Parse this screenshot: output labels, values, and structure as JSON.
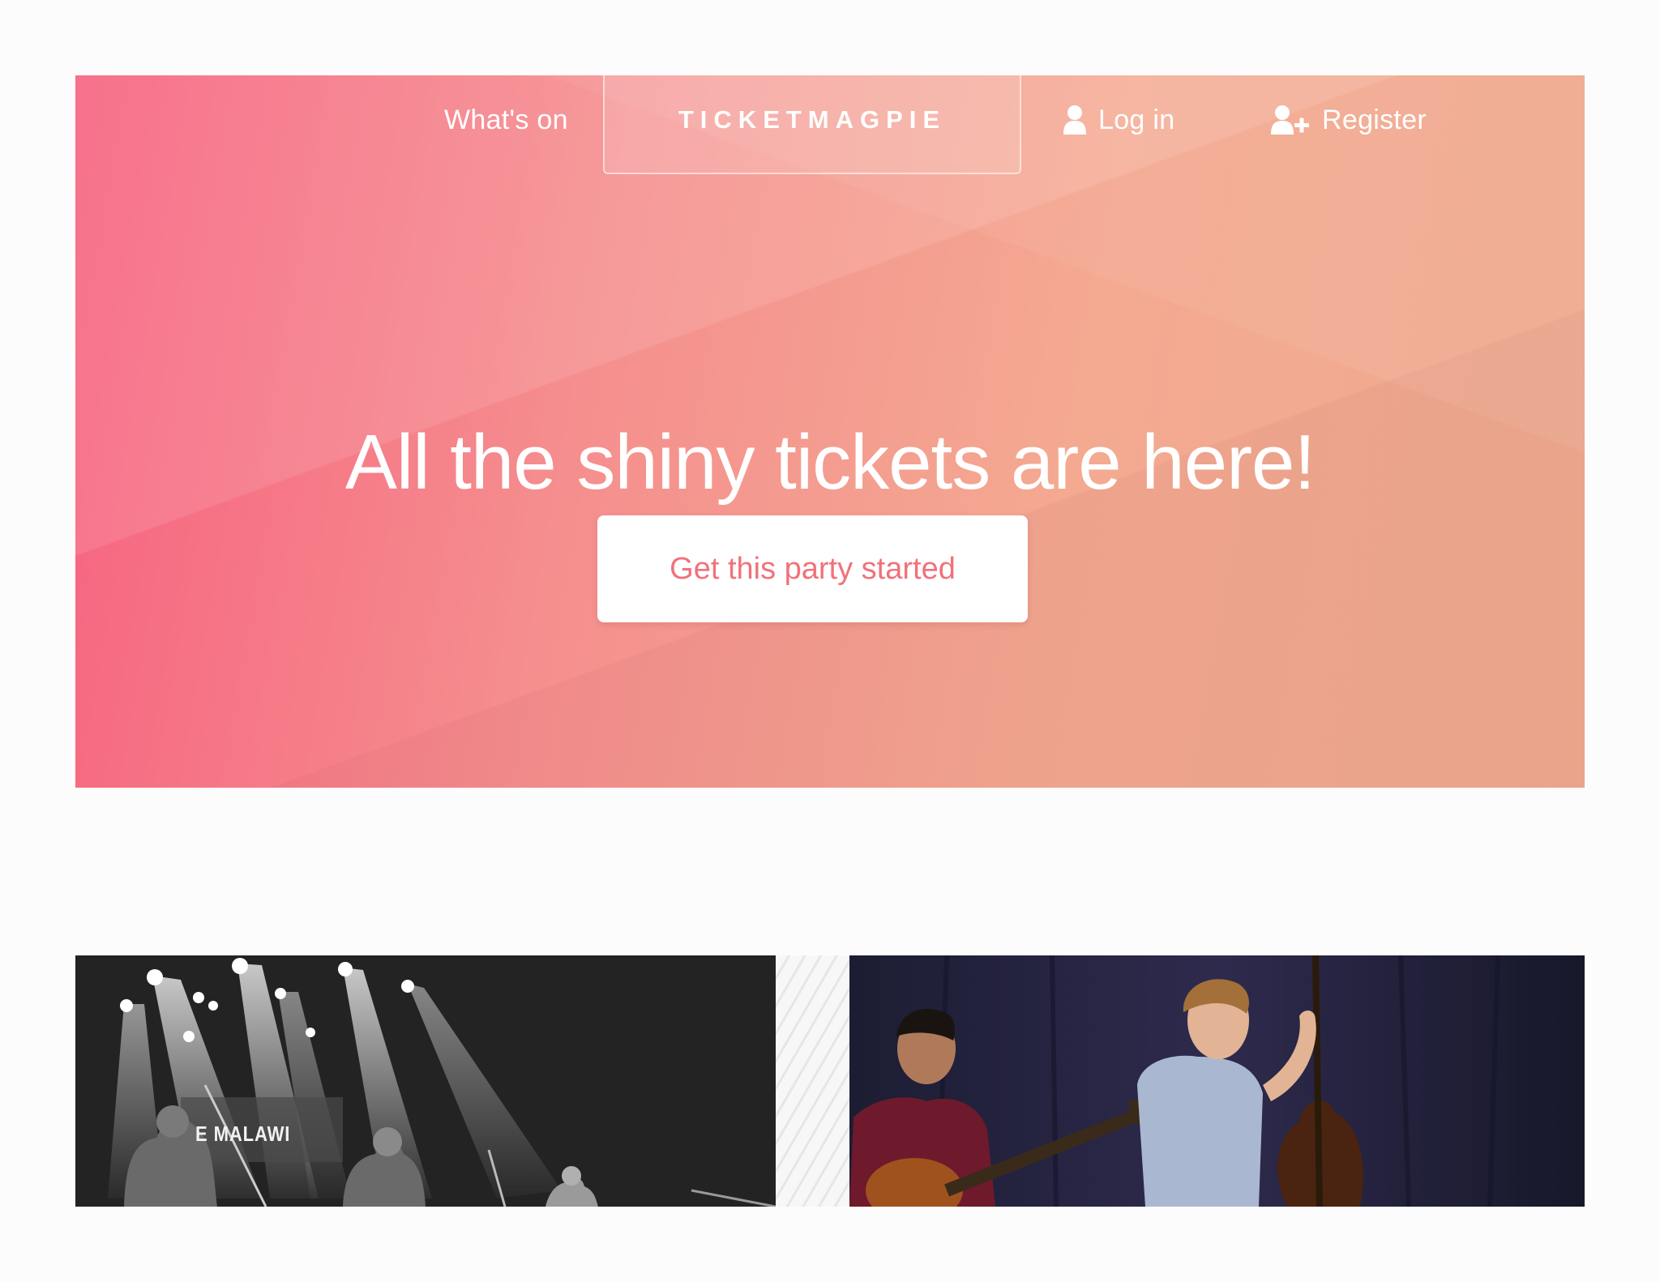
{
  "brand": {
    "name": "TICKETMAGPIE"
  },
  "nav": {
    "whats_on": "What's on",
    "login": "Log in",
    "register": "Register"
  },
  "hero": {
    "headline": "All the shiny tickets are here!",
    "cta_label": "Get this party started"
  },
  "gallery": {
    "photo1_label": "E MALAWI"
  },
  "colors": {
    "gradient_start": "#f6617f",
    "gradient_end": "#eeab8f",
    "cta_text": "#f0727a"
  },
  "icons": {
    "login": "user-icon",
    "register": "user-plus-icon"
  }
}
